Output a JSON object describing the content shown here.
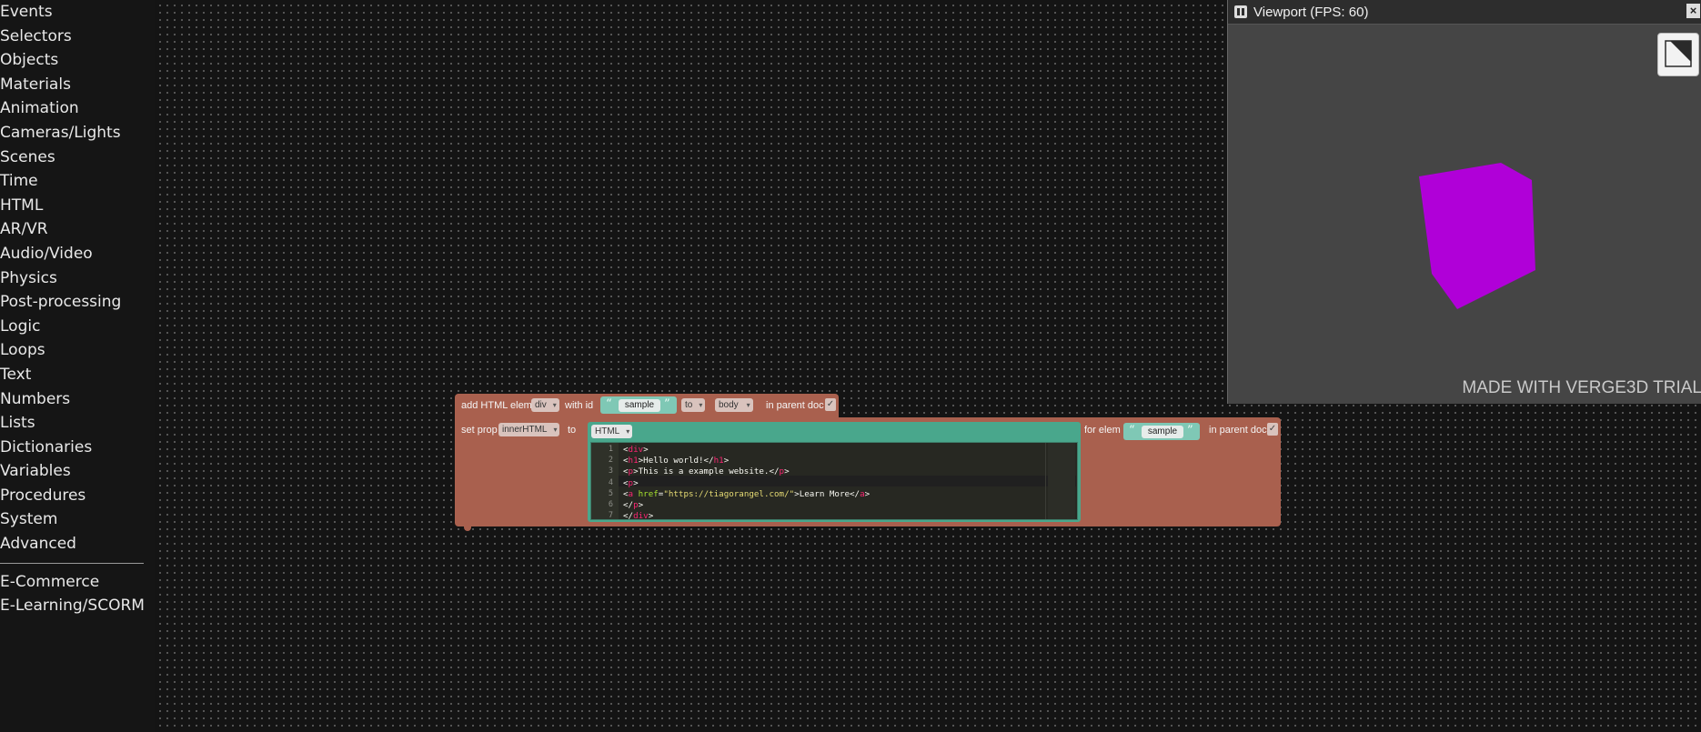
{
  "toolbox": {
    "categories": [
      "Events",
      "Selectors",
      "Objects",
      "Materials",
      "Animation",
      "Cameras/Lights",
      "Scenes",
      "Time",
      "HTML",
      "AR/VR",
      "Audio/Video",
      "Physics",
      "Post-processing",
      "Logic",
      "Loops",
      "Text",
      "Numbers",
      "Lists",
      "Dictionaries",
      "Variables",
      "Procedures",
      "System",
      "Advanced"
    ],
    "extras": [
      "E-Commerce",
      "E-Learning/SCORM"
    ]
  },
  "blocks": {
    "add_elem": {
      "label": "add HTML elem",
      "elem_type": "div",
      "with_id_label": "with id",
      "id_value": "sample",
      "to_label": "to",
      "to_dropdown": "to",
      "parent_value": "body",
      "parent_doc_label": "in parent doc",
      "checked": "✓"
    },
    "set_prop": {
      "label": "set prop",
      "prop": "innerHTML",
      "to_label": "to",
      "code_type": "HTML",
      "for_elem_label": "for elem",
      "elem_id": "sample",
      "parent_doc_label": "in parent doc",
      "checked": "✓"
    },
    "code_lines": [
      {
        "n": "1",
        "text": "<div>"
      },
      {
        "n": "2",
        "text": "<h1>Hello world!</h1>"
      },
      {
        "n": "3",
        "text": "<p>This is a example website.</p>"
      },
      {
        "n": "4",
        "text": "<p>"
      },
      {
        "n": "5",
        "text": "<a href=\"https://tiagorangel.com/\">Learn More</a>"
      },
      {
        "n": "6",
        "text": "</p>"
      },
      {
        "n": "7",
        "text": "</div>"
      }
    ]
  },
  "viewport": {
    "title": "Viewport (FPS: 60)",
    "watermark": "MADE WITH VERGE3D TRIAL",
    "cube_color": "#b000d8"
  }
}
